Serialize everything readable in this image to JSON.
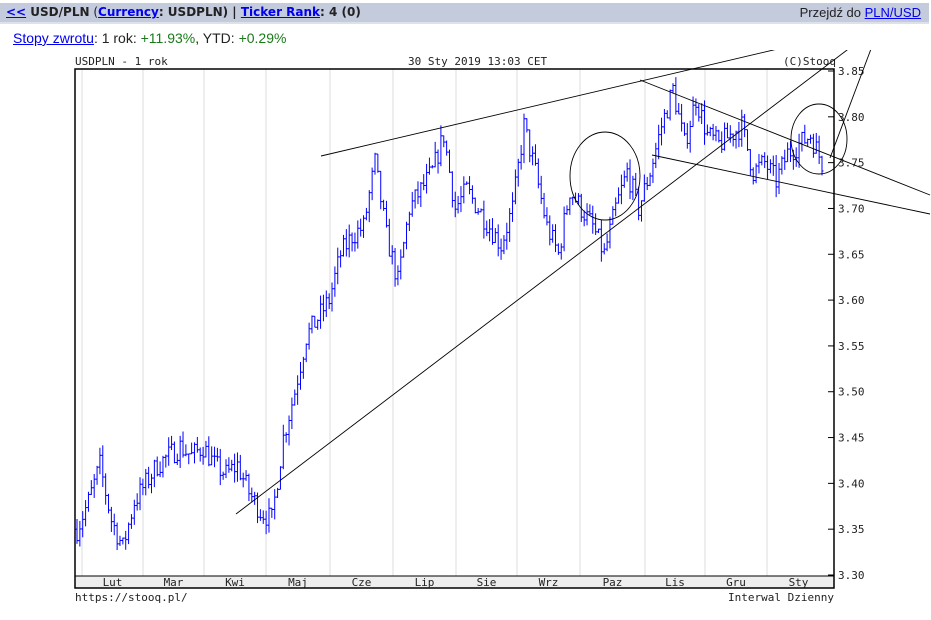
{
  "header": {
    "back": "<<",
    "symbol": "USD/PLN",
    "open_paren": " (",
    "currency_link": "Currency",
    "currency_rest": ": USDPLN) | ",
    "rank_link": "Ticker Rank",
    "rank_value": ": 4 (0)",
    "goto_label": "Przejdź do ",
    "goto_link": "PLN/USD"
  },
  "returns": {
    "link": "Stopy zwrotu",
    "label1": ": 1 rok: ",
    "val1": "+11.93%",
    "sep": ", YTD: ",
    "val2": "+0.29%"
  },
  "colors": {
    "bars": "#0000ff",
    "header": "#c4cbdc"
  },
  "chart_data": {
    "type": "ohlc",
    "title": "USDPLN - 1 rok",
    "date": "30 Sty 2019 13:03 CET",
    "copyright": "(C)Stooq",
    "footer_left": "https://stooq.pl/",
    "footer_right": "Interwal Dzienny",
    "ylim": [
      3.3,
      3.85
    ],
    "yticks": [
      "3.85",
      "3.80",
      "3.75",
      "3.70",
      "3.65",
      "3.60",
      "3.55",
      "3.50",
      "3.45",
      "3.40",
      "3.35",
      "3.30"
    ],
    "months": [
      "Lut",
      "Mar",
      "Kwi",
      "Maj",
      "Cze",
      "Lip",
      "Sie",
      "Wrz",
      "Paz",
      "Lis",
      "Gru",
      "Sty"
    ],
    "weekly_close": [
      3.35,
      3.38,
      3.42,
      3.36,
      3.33,
      3.38,
      3.4,
      3.42,
      3.43,
      3.44,
      3.43,
      3.44,
      3.42,
      3.41,
      3.42,
      3.39,
      3.37,
      3.36,
      3.45,
      3.5,
      3.56,
      3.58,
      3.6,
      3.65,
      3.67,
      3.68,
      3.75,
      3.67,
      3.62,
      3.7,
      3.72,
      3.74,
      3.78,
      3.7,
      3.72,
      3.7,
      3.68,
      3.66,
      3.7,
      3.79,
      3.74,
      3.68,
      3.65,
      3.72,
      3.7,
      3.68,
      3.65,
      3.7,
      3.74,
      3.7,
      3.74,
      3.79,
      3.83,
      3.77,
      3.82,
      3.78,
      3.77,
      3.78,
      3.79,
      3.74,
      3.75,
      3.73,
      3.76,
      3.77,
      3.78,
      3.75
    ]
  }
}
